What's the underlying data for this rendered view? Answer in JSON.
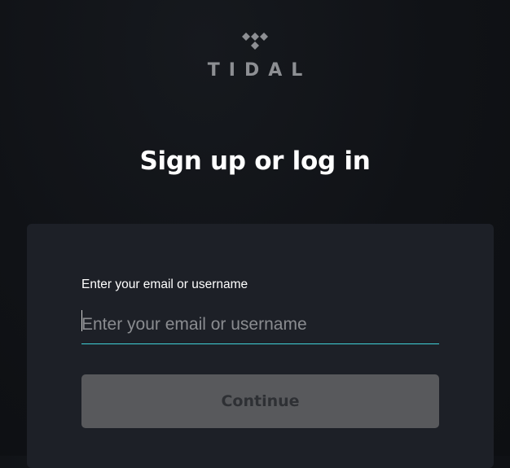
{
  "brand": {
    "logo_icon": "tidal-diamonds-icon",
    "wordmark": "TIDAL",
    "wordmark_color": "#8d8f93"
  },
  "heading": "Sign up or log in",
  "login_form": {
    "email_label": "Enter your email or username",
    "email_value": "",
    "email_placeholder": "Enter your email or username",
    "continue_label": "Continue"
  },
  "colors": {
    "background": "#111317",
    "card": "#1d2027",
    "input_underline": "#3fd1d7",
    "button_disabled": "#58595c"
  }
}
